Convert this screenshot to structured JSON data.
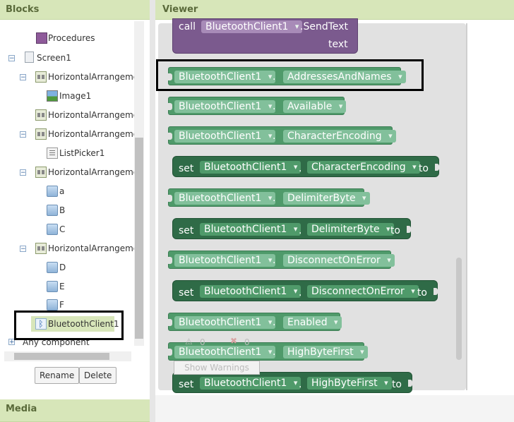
{
  "blocks_panel": {
    "title": "Blocks",
    "tree": [
      {
        "label": "Procedures",
        "icon": "procedures-icon"
      },
      {
        "label": "Screen1",
        "icon": "screen-icon"
      },
      {
        "label": "HorizontalArrangemer",
        "icon": "horizontal-arrangement-icon"
      },
      {
        "label": "Image1",
        "icon": "image-icon"
      },
      {
        "label": "HorizontalArrangemer",
        "icon": "horizontal-arrangement-icon"
      },
      {
        "label": "HorizontalArrangemer",
        "icon": "horizontal-arrangement-icon"
      },
      {
        "label": "ListPicker1",
        "icon": "listpicker-icon"
      },
      {
        "label": "HorizontalArrangemer",
        "icon": "horizontal-arrangement-icon"
      },
      {
        "label": "a",
        "icon": "button-icon"
      },
      {
        "label": "B",
        "icon": "button-icon"
      },
      {
        "label": "C",
        "icon": "button-icon"
      },
      {
        "label": "HorizontalArrangemer",
        "icon": "horizontal-arrangement-icon"
      },
      {
        "label": "D",
        "icon": "button-icon"
      },
      {
        "label": "E",
        "icon": "button-icon"
      },
      {
        "label": "F",
        "icon": "button-icon"
      },
      {
        "label": "BluetoothClient1",
        "icon": "bluetooth-icon"
      },
      {
        "label": "Any component",
        "icon": ""
      }
    ],
    "rename_label": "Rename",
    "delete_label": "Delete"
  },
  "media_panel": {
    "title": "Media"
  },
  "viewer": {
    "title": "Viewer",
    "top_block": {
      "call": "call",
      "component": "BluetoothClient1",
      "method": ".SendText",
      "arg": "text"
    },
    "blocks": [
      {
        "kind": "get",
        "component": "BluetoothClient1",
        "property": "AddressesAndNames"
      },
      {
        "kind": "get",
        "component": "BluetoothClient1",
        "property": "Available"
      },
      {
        "kind": "get",
        "component": "BluetoothClient1",
        "property": "CharacterEncoding"
      },
      {
        "kind": "set",
        "component": "BluetoothClient1",
        "property": "CharacterEncoding"
      },
      {
        "kind": "get",
        "component": "BluetoothClient1",
        "property": "DelimiterByte"
      },
      {
        "kind": "set",
        "component": "BluetoothClient1",
        "property": "DelimiterByte"
      },
      {
        "kind": "get",
        "component": "BluetoothClient1",
        "property": "DisconnectOnError"
      },
      {
        "kind": "set",
        "component": "BluetoothClient1",
        "property": "DisconnectOnError"
      },
      {
        "kind": "get",
        "component": "BluetoothClient1",
        "property": "Enabled"
      },
      {
        "kind": "get",
        "component": "BluetoothClient1",
        "property": "HighByteFirst"
      },
      {
        "kind": "set",
        "component": "BluetoothClient1",
        "property": "HighByteFirst"
      }
    ],
    "set_word": "set",
    "to_word": "to",
    "dot": ".",
    "warning_count": "0",
    "error_count": "0",
    "show_warnings_label": "Show Warnings"
  }
}
